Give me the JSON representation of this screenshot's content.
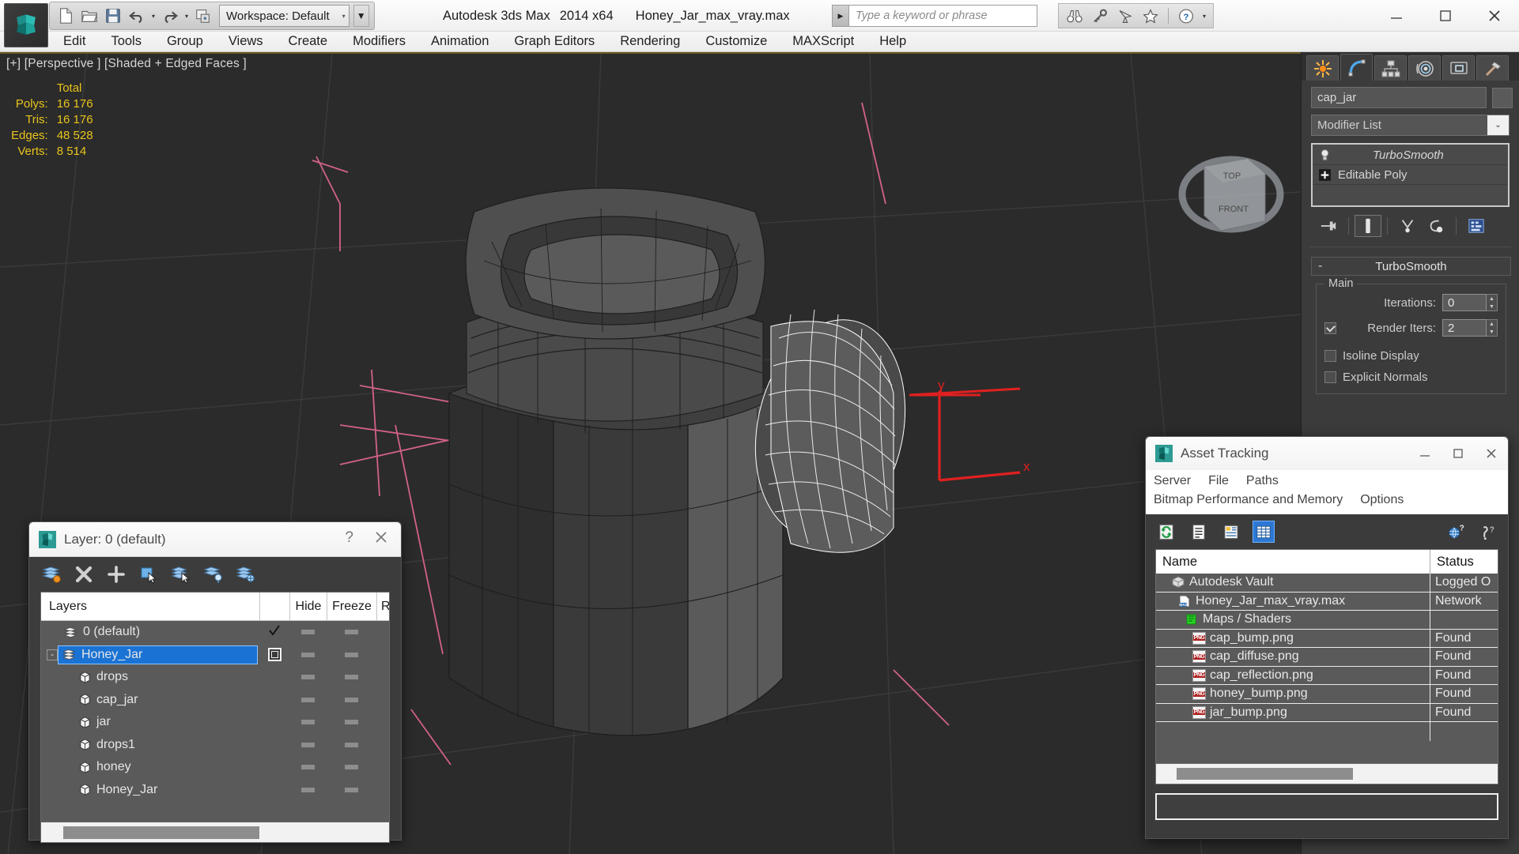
{
  "titlebar": {
    "workspace_label": "Workspace: Default",
    "app_name": "Autodesk 3ds Max",
    "app_version": "2014 x64",
    "file_name": "Honey_Jar_max_vray.max",
    "search_placeholder": "Type a keyword or phrase",
    "quick_access": [
      "new-icon",
      "open-icon",
      "save-icon",
      "undo-icon",
      "redo-icon",
      "project-icon"
    ],
    "right_icons": [
      "binoculars-icon",
      "key-icon",
      "satellite-icon",
      "star-icon",
      "help-icon"
    ],
    "window_controls": [
      "minimize",
      "maximize",
      "close"
    ]
  },
  "menubar": {
    "items": [
      "Edit",
      "Tools",
      "Group",
      "Views",
      "Create",
      "Modifiers",
      "Animation",
      "Graph Editors",
      "Rendering",
      "Customize",
      "MAXScript",
      "Help"
    ]
  },
  "viewport": {
    "label": "[+] [Perspective ] [Shaded + Edged Faces ]",
    "stats": {
      "header": "Total",
      "rows": [
        {
          "label": "Polys:",
          "value": "16 176"
        },
        {
          "label": "Tris:",
          "value": "16 176"
        },
        {
          "label": "Edges:",
          "value": "48 528"
        },
        {
          "label": "Verts:",
          "value": "8 514"
        }
      ]
    },
    "gizmo_axes": [
      "y",
      "x"
    ],
    "viewcube_faces": [
      "TOP",
      "FRONT"
    ],
    "bg_color": "#2b2b2b",
    "grid_color": "#d48fa8",
    "stats_color": "#e8c41c"
  },
  "command_panel": {
    "tabs": [
      "create-tab-icon",
      "modify-tab-icon",
      "hierarchy-tab-icon",
      "motion-tab-icon",
      "display-tab-icon",
      "utilities-tab-icon"
    ],
    "object_name": "cap_jar",
    "modifier_list_label": "Modifier List",
    "stack": [
      {
        "label": "TurboSmooth",
        "icon": "lightbulb-icon"
      },
      {
        "label": "Editable Poly",
        "icon": "plus-box-icon"
      }
    ],
    "rollout": {
      "title": "TurboSmooth",
      "collapse_glyph": "-",
      "group_title": "Main",
      "iterations_label": "Iterations:",
      "iterations_value": "0",
      "render_iters_label": "Render Iters:",
      "render_iters_value": "2",
      "render_iters_checked": true,
      "isoline_label": "Isoline Display",
      "isoline_checked": false,
      "explicit_label": "Explicit Normals",
      "explicit_checked": false
    }
  },
  "layer_dialog": {
    "title": "Layer: 0 (default)",
    "help_glyph": "?",
    "toolbar_icons": [
      "create-new-layer-icon",
      "delete-layer-icon",
      "add-layer-icon",
      "select-objects-in-layer-icon",
      "select-highlighted-layer-icon",
      "highlight-selected-objects-icon",
      "layer-properties-icon"
    ],
    "columns": [
      "Layers",
      "",
      "Hide",
      "Freeze",
      "R"
    ],
    "rows": [
      {
        "name": "0 (default)",
        "type": "layer",
        "indent": 0,
        "selected": false,
        "marker": "check",
        "hide": "dash",
        "freeze": "dash"
      },
      {
        "name": "Honey_Jar",
        "type": "layer",
        "indent": 0,
        "selected": true,
        "expander": "-",
        "marker": "box",
        "hide": "dash",
        "freeze": "dash"
      },
      {
        "name": "drops",
        "type": "object",
        "indent": 1,
        "selected": false,
        "marker": "",
        "hide": "dash",
        "freeze": "dash"
      },
      {
        "name": "cap_jar",
        "type": "object",
        "indent": 1,
        "selected": false,
        "marker": "",
        "hide": "dash",
        "freeze": "dash"
      },
      {
        "name": "jar",
        "type": "object",
        "indent": 1,
        "selected": false,
        "marker": "",
        "hide": "dash",
        "freeze": "dash"
      },
      {
        "name": "drops1",
        "type": "object",
        "indent": 1,
        "selected": false,
        "marker": "",
        "hide": "dash",
        "freeze": "dash"
      },
      {
        "name": "honey",
        "type": "object",
        "indent": 1,
        "selected": false,
        "marker": "",
        "hide": "dash",
        "freeze": "dash"
      },
      {
        "name": "Honey_Jar",
        "type": "object",
        "indent": 1,
        "selected": false,
        "marker": "",
        "hide": "dash",
        "freeze": "dash"
      }
    ],
    "selection_color": "#1a73d4"
  },
  "asset_tracking": {
    "title": "Asset Tracking",
    "menus_row1": [
      "Server",
      "File",
      "Paths"
    ],
    "menus_row2": [
      "Bitmap Performance and Memory",
      "Options"
    ],
    "toolbar_icons": [
      "refresh-icon",
      "list-view-icon",
      "detail-view-icon",
      "grid-view-icon"
    ],
    "toolbar_right_icons": [
      "help-globe-icon",
      "help-question-icon"
    ],
    "columns": {
      "name": "Name",
      "status": "Status"
    },
    "rows": [
      {
        "name": "Autodesk Vault",
        "status": "Logged O",
        "icon": "vault-icon",
        "indent": 0
      },
      {
        "name": "Honey_Jar_max_vray.max",
        "status": "Network",
        "icon": "max-file-icon",
        "indent": 1
      },
      {
        "name": "Maps / Shaders",
        "status": "",
        "icon": "maps-icon",
        "indent": 2
      },
      {
        "name": "cap_bump.png",
        "status": "Found",
        "icon": "png-icon",
        "indent": 3
      },
      {
        "name": "cap_diffuse.png",
        "status": "Found",
        "icon": "png-icon",
        "indent": 3
      },
      {
        "name": "cap_reflection.png",
        "status": "Found",
        "icon": "png-icon",
        "indent": 3
      },
      {
        "name": "honey_bump.png",
        "status": "Found",
        "icon": "png-icon",
        "indent": 3
      },
      {
        "name": "jar_bump.png",
        "status": "Found",
        "icon": "png-icon",
        "indent": 3
      }
    ]
  }
}
